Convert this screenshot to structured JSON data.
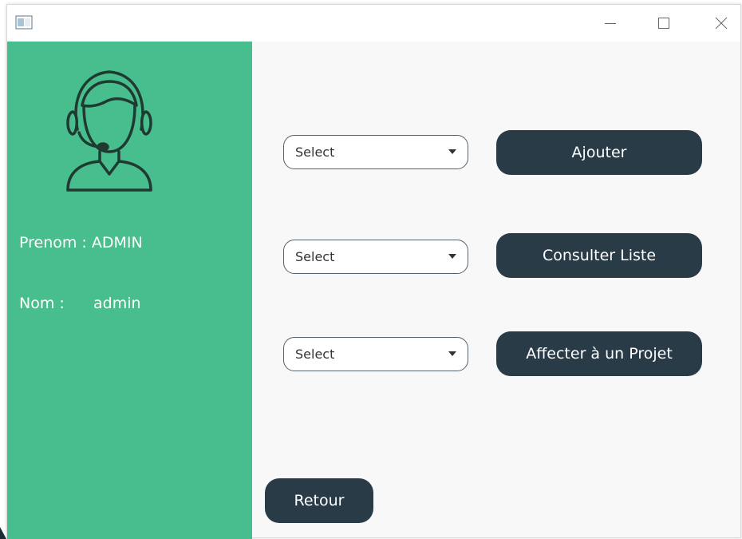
{
  "window": {
    "icon": "app-window-icon",
    "controls": [
      "minimize-icon",
      "maximize-icon",
      "close-icon"
    ]
  },
  "sidebar": {
    "avatar_icon": "support-agent-headset-icon",
    "prenom_line": "Prenom : ADMIN",
    "nom_label": "Nom :",
    "nom_value": "admin",
    "background_color": "#48be8e"
  },
  "main": {
    "rows": [
      {
        "select_value": "Select",
        "button_label": "Ajouter"
      },
      {
        "select_value": "Select",
        "button_label": "Consulter Liste"
      },
      {
        "select_value": "Select",
        "button_label": "Affecter à un Projet"
      }
    ],
    "back_button_label": "Retour",
    "button_color": "#2a3b48"
  }
}
